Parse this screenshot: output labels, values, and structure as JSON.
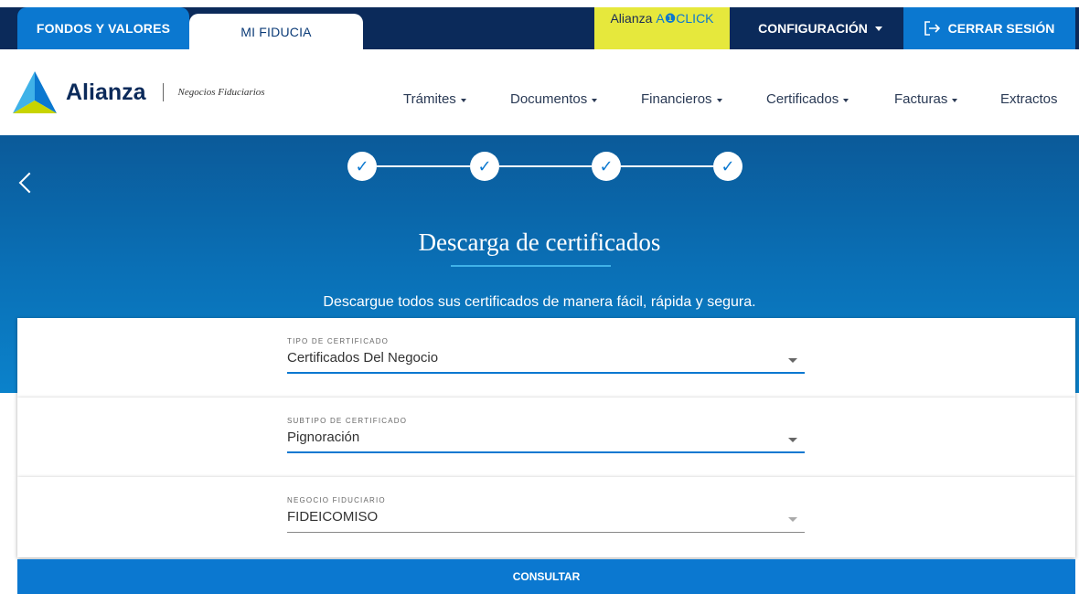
{
  "topbar": {
    "tab_fondos": "FONDOS Y VALORES",
    "tab_fiducia": "MI FIDUCIA",
    "oneclick_brand": "Alianza",
    "oneclick_suffix": "A❶CLICK",
    "config_label": "CONFIGURACIÓN",
    "logout_label": "CERRAR SESIÓN",
    "colors": {
      "navy": "#0b2a5a",
      "blue": "#0b78d0",
      "yellow": "#e6e83c"
    }
  },
  "header": {
    "logo_word": "Alianza",
    "logo_sub": "Negocios Fiduciarios",
    "nav": [
      {
        "label": "Trámites",
        "dropdown": true
      },
      {
        "label": "Documentos",
        "dropdown": true
      },
      {
        "label": "Financieros",
        "dropdown": true
      },
      {
        "label": "Certificados",
        "dropdown": true
      },
      {
        "label": "Facturas",
        "dropdown": true
      },
      {
        "label": "Extractos",
        "dropdown": false
      }
    ]
  },
  "hero": {
    "steps": [
      "✓",
      "✓",
      "✓",
      "✓"
    ],
    "title": "Descarga de certificados",
    "subtitle": "Descargue todos sus certificados de manera fácil, rápida y segura."
  },
  "form": {
    "tipo": {
      "label": "TIPO DE CERTIFICADO",
      "value": "Certificados Del Negocio"
    },
    "subtipo": {
      "label": "SUBTIPO DE CERTIFICADO",
      "value": "Pignoración"
    },
    "negocio": {
      "label": "NEGOCIO FIDUCIARIO",
      "value": "FIDEICOMISO"
    },
    "submit_label": "CONSULTAR"
  }
}
